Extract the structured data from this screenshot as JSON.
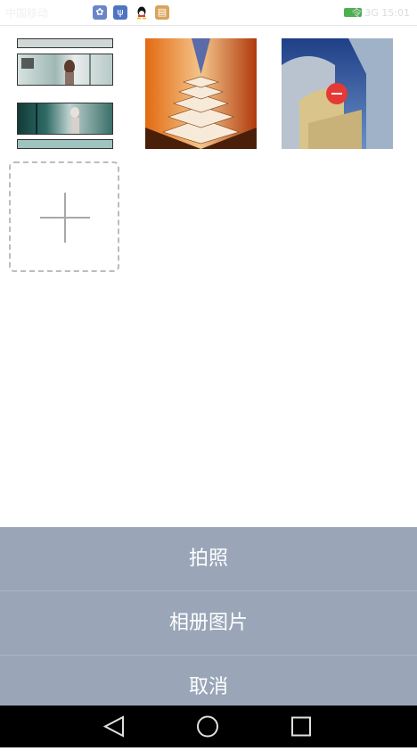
{
  "status_bar": {
    "carrier": "中国移动",
    "notification_icons": [
      "gallery-icon",
      "usb-icon",
      "qq-icon",
      "clipboard-icon"
    ],
    "right_info": "令 3G  15:01"
  },
  "grid": {
    "images": [
      {
        "name": "comic-strip-image"
      },
      {
        "name": "stairs-image"
      },
      {
        "name": "building-image",
        "has_remove_badge": true
      }
    ],
    "add_icon": "plus-icon"
  },
  "sheet": {
    "items": [
      {
        "label": "拍照"
      },
      {
        "label": "相册图片"
      },
      {
        "label": "取消"
      }
    ]
  },
  "navbar": {
    "buttons": [
      "back-icon",
      "home-icon",
      "recents-icon"
    ]
  },
  "colors": {
    "sheet_bg": "#9aa6b8",
    "remove_badge": "#e53935",
    "navbar_bg": "#000000"
  }
}
